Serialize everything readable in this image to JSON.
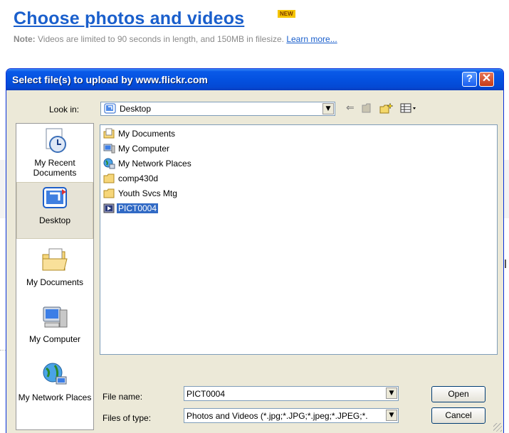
{
  "page": {
    "heading": "Choose photos and videos",
    "new_badge": "NEW",
    "note_label": "Note:",
    "note_text": " Videos are limited to 90 seconds in length, and 150MB in filesize. ",
    "learn_more": "Learn more..."
  },
  "dialog": {
    "title": "Select file(s) to upload by www.flickr.com",
    "help_label": "?",
    "close_label": "✕",
    "look_in_label": "Look in:",
    "look_in_value": "Desktop",
    "places": [
      {
        "label": "My Recent Documents",
        "icon": "recent-documents-icon"
      },
      {
        "label": "Desktop",
        "icon": "desktop-icon",
        "selected": true
      },
      {
        "label": "My Documents",
        "icon": "my-documents-icon"
      },
      {
        "label": "My Computer",
        "icon": "my-computer-icon"
      },
      {
        "label": "My Network Places",
        "icon": "network-places-icon"
      }
    ],
    "files": [
      {
        "name": "My Documents",
        "icon": "my-documents-icon"
      },
      {
        "name": "My Computer",
        "icon": "my-computer-icon"
      },
      {
        "name": "My Network Places",
        "icon": "network-places-icon"
      },
      {
        "name": "comp430d",
        "icon": "folder-icon"
      },
      {
        "name": "Youth Svcs Mtg",
        "icon": "folder-icon"
      },
      {
        "name": "PICT0004",
        "icon": "video-file-icon",
        "selected": true
      }
    ],
    "file_name_label": "File name:",
    "file_name_value": "PICT0004",
    "files_of_type_label": "Files of type:",
    "files_of_type_value": "Photos and Videos (*.jpg;*.JPG;*.jpeg;*.JPEG;*.",
    "open_label": "Open",
    "cancel_label": "Cancel"
  },
  "colors": {
    "title_blue": "#0451e0",
    "link_blue": "#1a5fcc",
    "selection": "#316ac5",
    "dialog_bg": "#ece9d8"
  }
}
